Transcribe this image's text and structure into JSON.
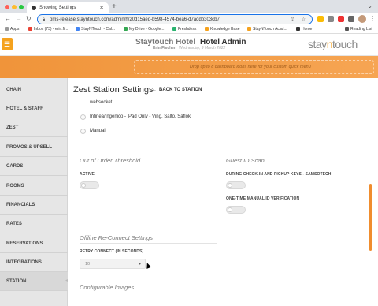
{
  "browser": {
    "tab_title": "Showing Settings",
    "url": "pms-release.stayntouch.com/admin/h/20d15aed-b598-4574-bea6-d7addb303cb7",
    "bookmarks": [
      "Apps",
      "Inbox (73) - erin.fi...",
      "StayNTouch - Cal...",
      "My Drive - Google...",
      "Freshdesk",
      "Knowledge Base",
      "StayNTouch Acad...",
      "Home"
    ],
    "reading_list": "Reading List"
  },
  "header": {
    "hotel_name": "Staytouch Hotel",
    "app_title": "Hotel Admin",
    "user_name": "Erin Fischer",
    "date": "Wednesday, 9 March 2022",
    "logo_prefix": "stay",
    "logo_mid": "n",
    "logo_suffix": "touch"
  },
  "dashboard": {
    "drop_text": "Drop up to 8 dashboard icons here for your custom quick menu"
  },
  "sidebar": {
    "items": [
      "CHAIN",
      "HOTEL & STAFF",
      "ZEST",
      "PROMOS & UPSELL",
      "CARDS",
      "ROOMS",
      "FINANCIALS",
      "RATES",
      "RESERVATIONS",
      "INTEGRATIONS",
      "STATION"
    ]
  },
  "main": {
    "title": "Zest Station Settings",
    "back_label": "BACK TO STATION",
    "websocket_label": "websocket",
    "radio_options": [
      "Infinea/Ingenico - iPad Only - Ving, Salto, Saflok",
      "Manual"
    ],
    "out_of_order": {
      "title": "Out of Order Threshold",
      "active_label": "ACTIVE",
      "active": false
    },
    "guest_id": {
      "title": "Guest ID Scan",
      "checkin_label": "DURING CHECK-IN AND PICKUP KEYS - SAMSOTECH",
      "checkin_on": false,
      "manual_label": "ONE-TIME MANUAL ID VERIFICATION",
      "manual_on": false
    },
    "offline": {
      "title": "Offline Re-Connect Settings",
      "retry_label": "RETRY CONNECT (IN SECONDS)",
      "retry_value": "10"
    },
    "images": {
      "title": "Configurable Images"
    }
  },
  "colors": {
    "accent": "#f5a21e",
    "band": "#f0943a"
  }
}
